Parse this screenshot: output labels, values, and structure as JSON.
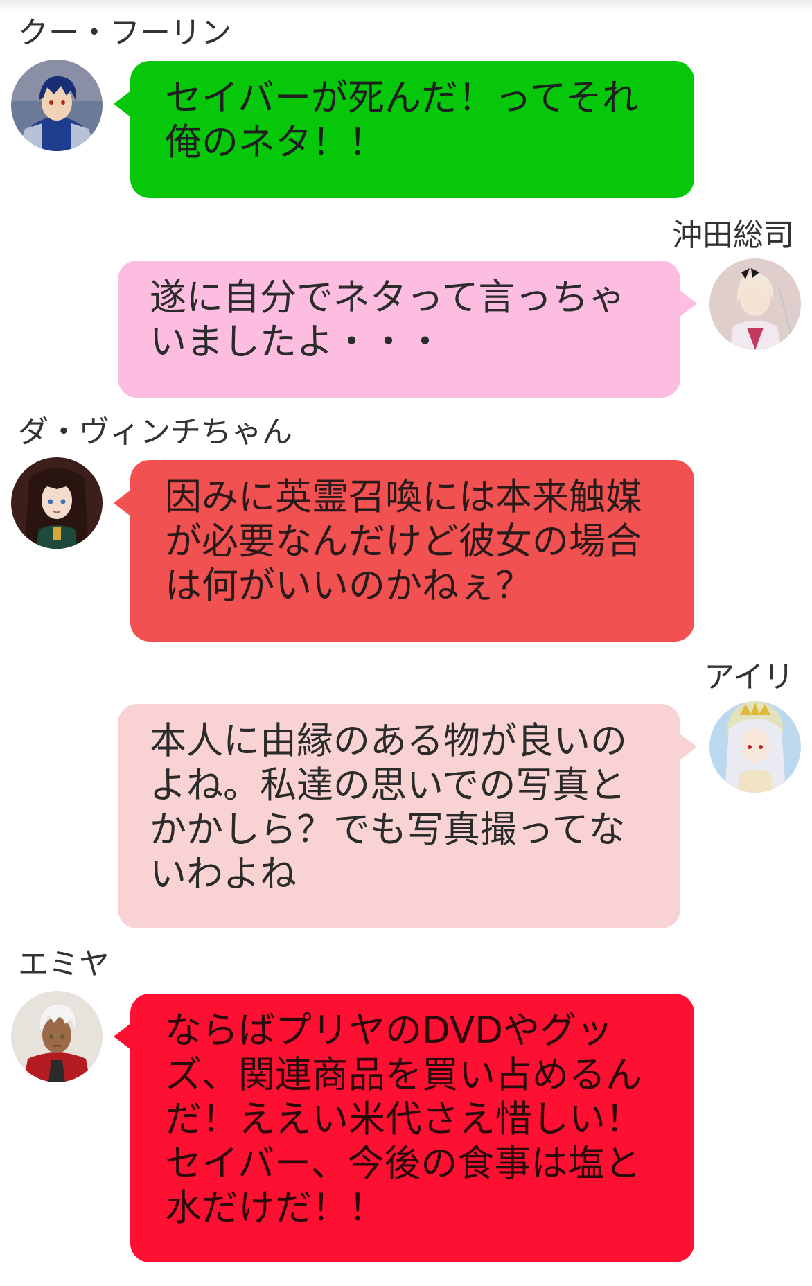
{
  "messages": [
    {
      "sender": "クー・フーリン",
      "side": "left",
      "text": "セイバーが死んだ！ってそれ\n俺のネタ！！",
      "bubble_color": "#06c709",
      "text_color": "#1f1f1f",
      "avatar_icon": "blue-knight-avatar"
    },
    {
      "sender": "沖田総司",
      "side": "right",
      "text": "遂に自分でネタって言っちゃ\nいましたよ・・・",
      "bubble_color": "#fdbde0",
      "text_color": "#2b2b2b",
      "avatar_icon": "white-haired-girl-avatar"
    },
    {
      "sender": "ダ・ヴィンチちゃん",
      "side": "left",
      "text": "因みに英霊召喚には本来触媒\nが必要なんだけど彼女の場合\nは何がいいのかねぇ？",
      "bubble_color": "#f15150",
      "text_color": "#2a1a1a",
      "avatar_icon": "dark-haired-woman-avatar"
    },
    {
      "sender": "アイリ",
      "side": "right",
      "text": "本人に由縁のある物が良いの\nよね。私達の思いでの写真と\nかかしら？でも写真撮ってな\nいわよね",
      "bubble_color": "#f9d2d3",
      "text_color": "#2b2b2b",
      "avatar_icon": "silver-haired-woman-avatar"
    },
    {
      "sender": "エミヤ",
      "side": "left",
      "text": "ならばプリヤのDVDやグッ\nズ、関連商品を買い占めるん\nだ！ええい米代さえ惜しい！\nセイバー、今後の食事は塩と\n水だけだ！！",
      "bubble_color": "#fd1031",
      "text_color": "#2a0a0a",
      "avatar_icon": "white-haired-man-avatar"
    }
  ]
}
